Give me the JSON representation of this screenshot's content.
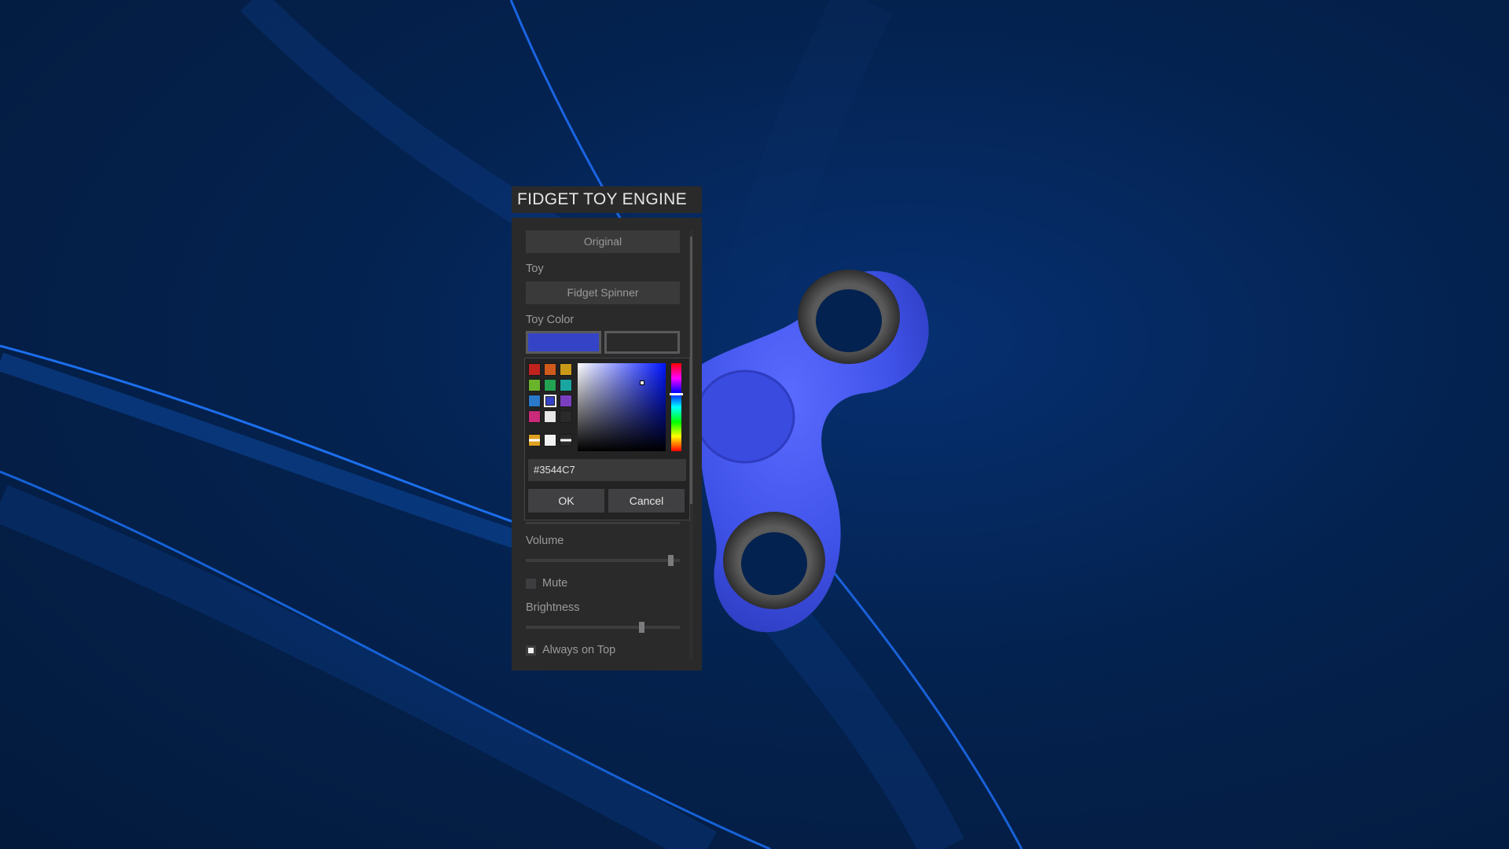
{
  "app": {
    "title": "FIDGET TOY ENGINE"
  },
  "panel": {
    "preset_button": "Original",
    "toy_label": "Toy",
    "toy_button": "Fidget Spinner",
    "toy_color_label": "Toy Color",
    "primary_color": "#3544C7",
    "volume_label": "Volume",
    "volume_level": 0.96,
    "mute_label": "Mute",
    "mute_checked": false,
    "brightness_label": "Brightness",
    "brightness_level": 0.76,
    "always_on_top_label": "Always on Top",
    "always_on_top_checked": true
  },
  "color_picker": {
    "presets": [
      "#c0231e",
      "#cf5a1c",
      "#c99a18",
      "#6ab42c",
      "#23a352",
      "#19a6a0",
      "#2a78c9",
      "#3544c7",
      "#7a3fc0",
      "#c92a7a",
      "#e6e6e6",
      "#2a2a2a"
    ],
    "selected_preset": 7,
    "hex_value": "#3544C7",
    "ok_label": "OK",
    "cancel_label": "Cancel",
    "saturation": 0.73,
    "brightness": 0.78,
    "hue_degrees": 235
  },
  "toy": {
    "color": "#3f52e8",
    "name": "fidget-spinner"
  }
}
